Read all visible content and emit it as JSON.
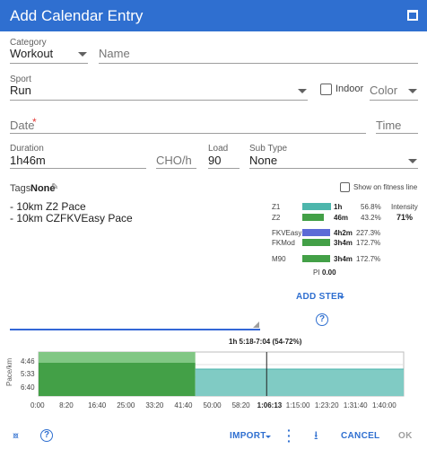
{
  "title": "Add Calendar Entry",
  "form": {
    "category_label": "Category",
    "category_value": "Workout",
    "name_placeholder": "Name",
    "sport_label": "Sport",
    "sport_value": "Run",
    "indoor_label": "Indoor",
    "color_placeholder": "Color",
    "date_placeholder": "Date",
    "date_required_mark": "*",
    "time_placeholder": "Time",
    "duration_label": "Duration",
    "duration_value": "1h46m",
    "cho_placeholder": "CHO/h",
    "load_label": "Load",
    "load_value": "90",
    "subtype_label": "Sub Type",
    "subtype_value": "None"
  },
  "tags": {
    "label": "Tags",
    "value": "None"
  },
  "show_on_fitness_line_label": "Show on fitness line",
  "workout_text": [
    "- 10km Z2 Pace",
    "- 10km CZFKVEasy Pace"
  ],
  "zones": [
    {
      "label": "Z1",
      "time": "1h",
      "pct": "56.8%",
      "color": "#4db6ac",
      "fill": 0.568
    },
    {
      "label": "Z2",
      "time": "46m",
      "pct": "43.2%",
      "color": "#43a047",
      "fill": 0.432
    }
  ],
  "intensity": {
    "label": "Intensity",
    "value": "71%"
  },
  "metrics": [
    {
      "label": "FKVEasy",
      "time": "4h2m",
      "pct": "227.3%",
      "color": "#5c6bd6"
    },
    {
      "label": "FKMod",
      "time": "3h4m",
      "pct": "172.7%",
      "color": "#43a047"
    },
    {
      "label": "M90",
      "time": "3h4m",
      "pct": "172.7%",
      "color": "#43a047"
    }
  ],
  "pi": {
    "label": "PI",
    "value": "0.00"
  },
  "add_step_label": "ADD STEP",
  "help_glyph": "?",
  "chart_data": {
    "type": "area",
    "title": "1h 5:18-7:04 (54-72%)",
    "ylabel": "Pace/km",
    "y_ticks": [
      "4:46",
      "5:33",
      "6:40"
    ],
    "x_ticks": [
      "0:00",
      "8:20",
      "16:40",
      "25:00",
      "33:20",
      "41:40",
      "50:00",
      "58:20",
      "1:06:13",
      "1:15:00",
      "1:23:20",
      "1:31:40",
      "1:40:00"
    ],
    "xlim_seconds": [
      0,
      6360
    ],
    "marker_seconds": 3973,
    "segments": [
      {
        "name": "Z2",
        "start_seconds": 0,
        "end_seconds": 2730,
        "color": "#43a047"
      },
      {
        "name": "Z1",
        "start_seconds": 2730,
        "end_seconds": 6360,
        "color": "#80cbc4"
      }
    ]
  },
  "footer": {
    "import_label": "IMPORT",
    "cancel_label": "CANCEL",
    "ok_label": "OK"
  },
  "colors": {
    "accent": "#2f6fd0",
    "titlebar": "#2f6fd0",
    "required": "#e53935"
  }
}
